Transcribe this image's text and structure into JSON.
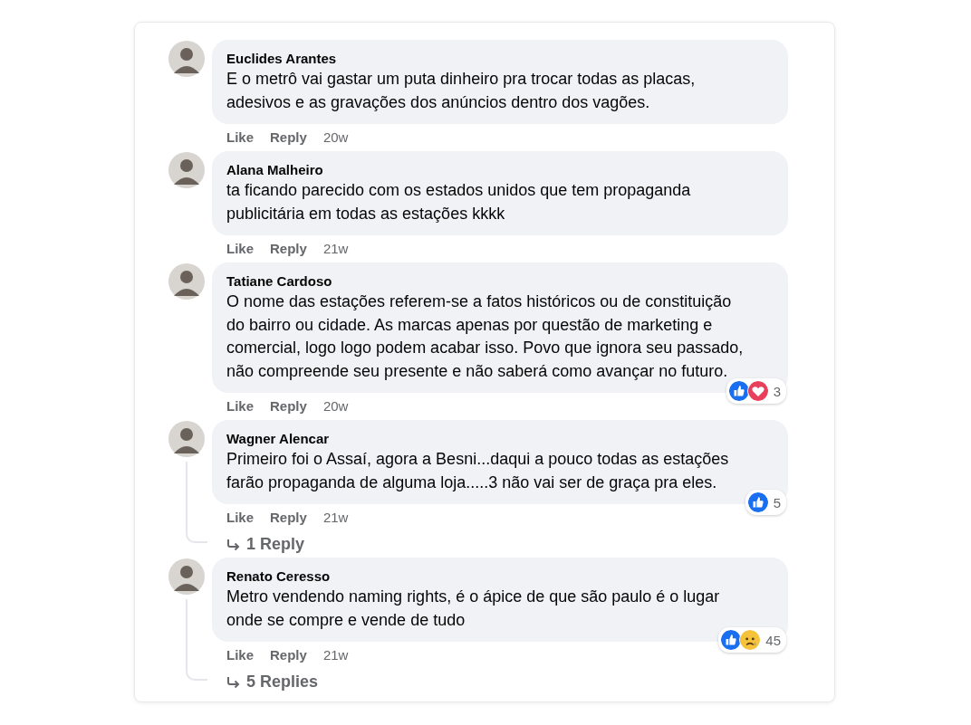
{
  "comments": [
    {
      "author": "Euclides Arantes",
      "lines": [
        "E o metrô vai gastar um puta dinheiro pra trocar todas as placas,",
        "adesivos e as gravações dos anúncios dentro dos vagões."
      ],
      "actions": [
        "Like",
        "Reply"
      ],
      "time": "20w"
    },
    {
      "author": "Alana Malheiro",
      "lines": [
        "ta ficando parecido com os estados unidos que tem propaganda",
        "publicitária em todas as estações kkkk"
      ],
      "actions": [
        "Like",
        "Reply"
      ],
      "time": "21w"
    },
    {
      "author": "Tatiane Cardoso",
      "lines": [
        "O nome das estações referem-se a fatos históricos ou de constituição",
        "do bairro ou cidade. As marcas apenas por questão de marketing e",
        "comercial, logo logo podem acabar isso. Povo que ignora seu passado,",
        "não compreende seu presente e não saberá como avançar no futuro."
      ],
      "actions": [
        "Like",
        "Reply"
      ],
      "time": "20w",
      "reactions": {
        "items": [
          {
            "kind": "like"
          },
          {
            "kind": "love"
          }
        ],
        "count": "3"
      }
    },
    {
      "author": "Wagner Alencar",
      "lines": [
        "Primeiro foi o Assaí, agora a Besni...daqui a pouco todas as estações",
        "farão propaganda de alguma loja.....3 não vai ser de graça pra eles."
      ],
      "actions": [
        "Like",
        "Reply"
      ],
      "time": "21w",
      "reactions": {
        "items": [
          {
            "kind": "like"
          }
        ],
        "count": "5"
      },
      "replies": "1 Reply"
    },
    {
      "author": "Renato Ceresso",
      "lines": [
        "Metro vendendo naming rights, é o ápice de que são paulo é o lugar",
        "onde se compre e vende de tudo"
      ],
      "actions": [
        "Like",
        "Reply"
      ],
      "time": "21w",
      "reactions": {
        "items": [
          {
            "kind": "like"
          },
          {
            "kind": "sad"
          }
        ],
        "count": "45"
      },
      "replies": "5 Replies"
    }
  ]
}
